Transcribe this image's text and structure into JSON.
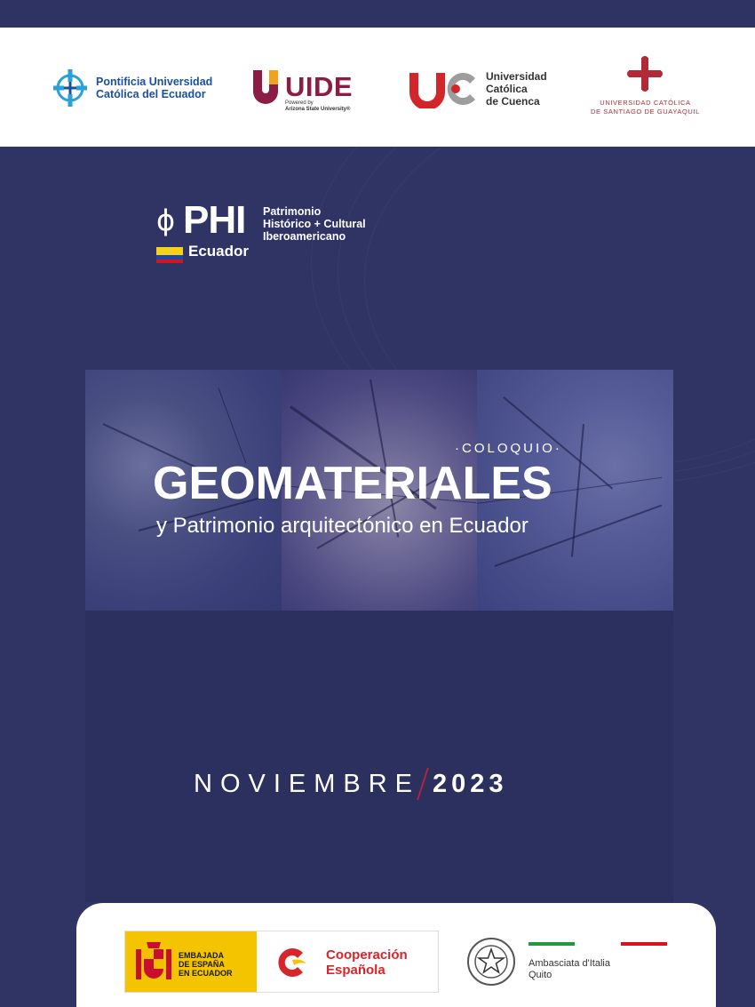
{
  "header": {
    "logos": [
      {
        "name": "puce",
        "lines": [
          "Pontificia Universidad",
          "Católica del Ecuador"
        ],
        "color": "#1b4f9c"
      },
      {
        "name": "uide",
        "word": "UIDE",
        "sub": [
          "Powered by",
          "Arizona State University®"
        ],
        "color": "#8b1d45"
      },
      {
        "name": "ucc",
        "lines": [
          "Universidad",
          "Católica",
          "de Cuenca"
        ],
        "color": "#d3262b"
      },
      {
        "name": "ucsg",
        "lines": [
          "UNIVERSIDAD CATÓLICA",
          "DE SANTIAGO DE GUAYAQUIL"
        ],
        "color": "#b22a36"
      }
    ]
  },
  "phi": {
    "symbol": "ϕ",
    "acronym": "PHI",
    "tagline": [
      "Patrimonio",
      "Histórico + Cultural",
      "Iberoamericano"
    ],
    "country": "Ecuador",
    "flag_colors": [
      "#f7d117",
      "#1c46a8",
      "#d7141a"
    ]
  },
  "event": {
    "kicker": "·COLOQUIO·",
    "title": "GEOMATERIALES",
    "subtitle": "y Patrimonio arquitectónico en Ecuador",
    "month": "NOVIEMBRE",
    "year": "2023",
    "accent": "#b8233f"
  },
  "footer": {
    "spain": {
      "embassy": [
        "EMBAJADA",
        "DE ESPAÑA",
        "EN ECUADOR"
      ],
      "coop": [
        "Cooperación",
        "Española"
      ],
      "colors": {
        "yellow": "#f5c400",
        "red": "#d6262b"
      }
    },
    "italy": {
      "lines": [
        "Ambasciata d'Italia",
        "Quito"
      ],
      "bar_colors": [
        "#1e9a3b",
        "#ffffff",
        "#d7141a"
      ]
    }
  },
  "colors": {
    "navy": "#2f3465",
    "white": "#ffffff"
  }
}
